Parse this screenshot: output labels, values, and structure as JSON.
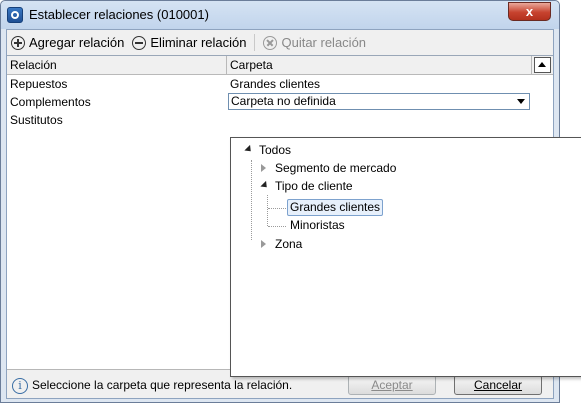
{
  "window": {
    "title": "Establecer relaciones (010001)",
    "close_label": "x"
  },
  "toolbar": {
    "add_label": "Agregar relación",
    "delete_label": "Eliminar relación",
    "remove_label": "Quitar relación"
  },
  "grid": {
    "columns": [
      "Relación",
      "Carpeta"
    ],
    "rows": [
      {
        "relation": "Repuestos",
        "folder": "Grandes clientes"
      },
      {
        "relation": "Complementos",
        "folder": "Carpeta no definida"
      },
      {
        "relation": "Sustitutos",
        "folder": ""
      }
    ]
  },
  "tree": {
    "root": "Todos",
    "items": [
      {
        "label": "Segmento de mercado",
        "expanded": false
      },
      {
        "label": "Tipo de cliente",
        "expanded": true,
        "children": [
          "Grandes clientes",
          "Minoristas"
        ],
        "selected": "Grandes clientes"
      },
      {
        "label": "Zona",
        "expanded": false
      }
    ]
  },
  "status": {
    "info_text": "Seleccione la carpeta que representa la relación.",
    "info_icon": "i"
  },
  "buttons": {
    "accept_label": "Aceptar",
    "cancel_label": "Cancelar",
    "accept_enabled": false
  }
}
